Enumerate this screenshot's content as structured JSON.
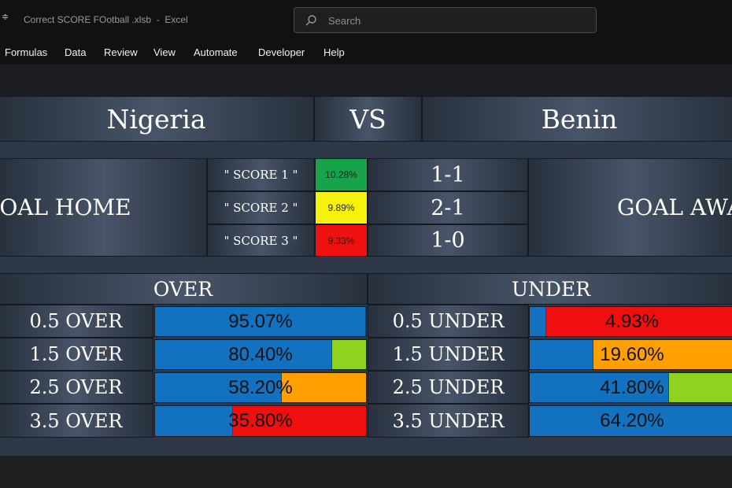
{
  "window": {
    "qa_glyph": "≑",
    "title": "Correct SCORE FOotball .xlsb  -  Excel",
    "search_placeholder": "Search"
  },
  "ribbon": {
    "tabs": [
      "Formulas",
      "Data",
      "Review",
      "View",
      "Automate",
      "Developer",
      "Help"
    ]
  },
  "match": {
    "home": "Nigeria",
    "vs": "VS",
    "away": "Benin"
  },
  "goals": {
    "home_label": "GOAL HOME",
    "away_label": "GOAL AWAY"
  },
  "scores": [
    {
      "label": "\" SCORE 1 \"",
      "percent": "10.28%",
      "result": "1-1",
      "color": "#16a34a"
    },
    {
      "label": "\" SCORE 2 \"",
      "percent": "9.89%",
      "result": "2-1",
      "color": "#f7f20c"
    },
    {
      "label": "\" SCORE 3 \"",
      "percent": "9.33%",
      "result": "1-0",
      "color": "#ef1010"
    }
  ],
  "over": {
    "header": "OVER",
    "rows": [
      {
        "label": "0.5 OVER",
        "value": "95.07%",
        "fill": 100,
        "bg": "#1372c0"
      },
      {
        "label": "1.5 OVER",
        "value": "80.40%",
        "fill": 84,
        "bg": "#8fd220"
      },
      {
        "label": "2.5 OVER",
        "value": "58.20%",
        "fill": 60,
        "bg": "#ff9f00"
      },
      {
        "label": "3.5 OVER",
        "value": "35.80%",
        "fill": 37,
        "bg": "#f00f0f"
      }
    ]
  },
  "under": {
    "header": "UNDER",
    "rows": [
      {
        "label": "0.5 UNDER",
        "value": "4.93%",
        "fill": 8,
        "bg": "#f00f0f"
      },
      {
        "label": "1.5 UNDER",
        "value": "19.60%",
        "fill": 31,
        "bg": "#ff9f00"
      },
      {
        "label": "2.5 UNDER",
        "value": "41.80%",
        "fill": 68,
        "bg": "#8fd220"
      },
      {
        "label": "3.5 UNDER",
        "value": "64.20%",
        "fill": 100,
        "bg": "#1372c0"
      }
    ]
  },
  "colors": {
    "bar_fill": "#1372c0",
    "panel": "#2f3847"
  }
}
